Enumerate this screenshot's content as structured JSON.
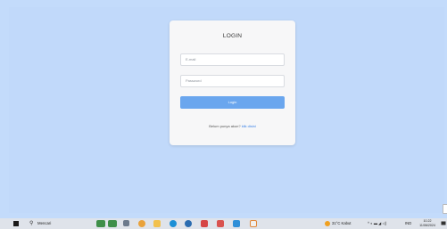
{
  "login": {
    "title": "LOGIN",
    "email_placeholder": "E-mail",
    "password_placeholder": "Password",
    "button_label": "Login",
    "register_prompt": "Belum punya akun?",
    "register_link": "klik disini"
  },
  "taskbar": {
    "search_label": "Mencari",
    "weather": "31°C Kabut",
    "language": "IND",
    "time": "10.22",
    "date": "11/06/2024"
  },
  "colors": {
    "background": "#c1d9fa",
    "card": "#f7f7f8",
    "button": "#6aa6ee",
    "link": "#3b82e6"
  },
  "icons": [
    "windows-start-icon",
    "search-icon",
    "file-explorer-icon",
    "chrome-icon",
    "edge-icon",
    "mail-icon",
    "store-icon",
    "vscode-icon",
    "weather-icon",
    "wifi-icon",
    "volume-icon",
    "battery-icon",
    "notification-icon"
  ]
}
